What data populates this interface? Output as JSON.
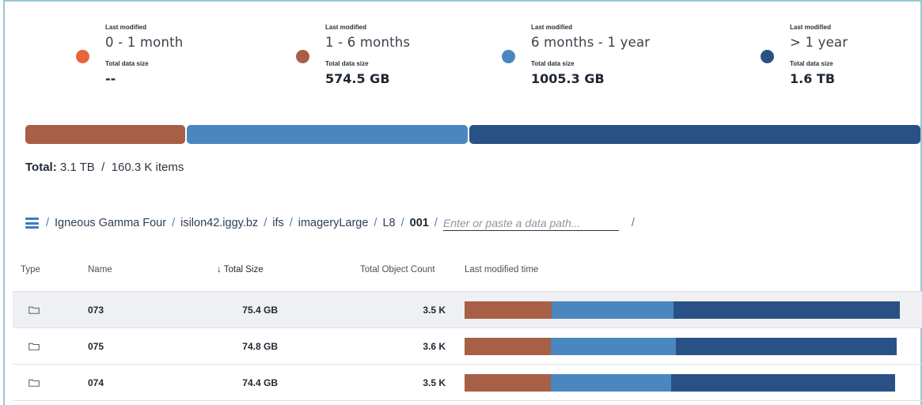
{
  "legend": [
    {
      "modified_label": "Last modified",
      "range": "0 - 1 month",
      "size_label": "Total data size",
      "size": "--",
      "color": "#e8643a"
    },
    {
      "modified_label": "Last modified",
      "range": "1 - 6 months",
      "size_label": "Total data size",
      "size": "574.5 GB",
      "color": "#a75f45"
    },
    {
      "modified_label": "Last modified",
      "range": "6 months - 1 year",
      "size_label": "Total data size",
      "size": "1005.3 GB",
      "color": "#4a87c0"
    },
    {
      "modified_label": "Last modified",
      "range": "> 1 year",
      "size_label": "Total data size",
      "size": "1.6 TB",
      "color": "#2a5186"
    }
  ],
  "distribution": [
    0.18,
    0.315,
    0.505
  ],
  "total": {
    "label": "Total:",
    "value": "3.1 TB  /  160.3 K items"
  },
  "breadcrumb": {
    "items": [
      "Igneous Gamma Four",
      "isilon42.iggy.bz",
      "ifs",
      "imageryLarge",
      "L8",
      "001"
    ],
    "input_placeholder": "Enter or paste a data path...",
    "separator": "/"
  },
  "table": {
    "headers": {
      "type": "Type",
      "name": "Name",
      "size": "Total Size",
      "sort_arrow": "↓",
      "count": "Total Object Count",
      "modified": "Last modified time"
    },
    "rows": [
      {
        "name": "073",
        "size": "75.4 GB",
        "count": "3.5 K",
        "dist": [
          0.2,
          0.28,
          0.52
        ]
      },
      {
        "name": "075",
        "size": "74.8 GB",
        "count": "3.6 K",
        "dist": [
          0.2,
          0.29,
          0.51
        ]
      },
      {
        "name": "074",
        "size": "74.4 GB",
        "count": "3.5 K",
        "dist": [
          0.2,
          0.28,
          0.52
        ]
      }
    ]
  },
  "icons": {
    "menu": "menu-icon",
    "folder": "folder-icon",
    "sort": "arrow-down-icon"
  }
}
